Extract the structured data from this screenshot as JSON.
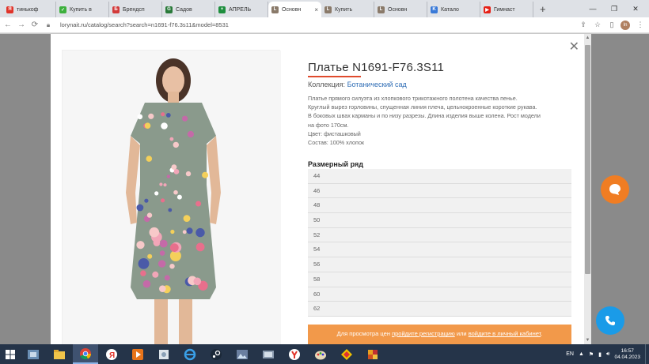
{
  "browser": {
    "tabs": [
      {
        "label": "тинькоф",
        "color": "#e0342a",
        "glyph": "Я"
      },
      {
        "label": "Купить в",
        "color": "#3db03d",
        "glyph": "✓"
      },
      {
        "label": "Брендсп",
        "color": "#d23a3a",
        "glyph": "Б"
      },
      {
        "label": "Садов",
        "color": "#2a7a3a",
        "glyph": "G"
      },
      {
        "label": "АПРЕЛЬ",
        "color": "#1e8e3e",
        "glyph": "+"
      },
      {
        "label": "Основн",
        "color": "#8a7a6a",
        "glyph": "L"
      },
      {
        "label": "Купить",
        "color": "#8a7a6a",
        "glyph": "L"
      },
      {
        "label": "Основн",
        "color": "#8a7a6a",
        "glyph": "L"
      },
      {
        "label": "Катало",
        "color": "#3a7ad8",
        "glyph": "K"
      },
      {
        "label": "Гимнаст",
        "color": "#e62117",
        "glyph": "▶"
      }
    ],
    "active_tab_index": 5,
    "url": "lorynait.ru/catalog/search?search=n1691-f76.3s11&model=8531",
    "avatar_initial": "In"
  },
  "product": {
    "title": "Платье N1691-F76.3S11",
    "collection_label": "Коллекция:",
    "collection_value": "Ботанический сад",
    "description": [
      "Платье прямого силуэта из хлопкового трикотажного полотена качества пенье.",
      "Круглый вырез горловины, спущенная линия плеча, цельнокроенные короткие рукава.",
      "В боковых швах карманы и по низу разрезы. Длина изделия выше колена. Рост модели",
      "на фото 170см.",
      "Цвет: фисташковый",
      "Состав: 100% хлопок"
    ],
    "sizes_heading": "Размерный ряд",
    "sizes": [
      "44",
      "46",
      "48",
      "50",
      "52",
      "54",
      "56",
      "58",
      "60",
      "62"
    ],
    "banner": {
      "prefix": "Для просмотра цен",
      "link1": "пройдите регистрацию",
      "middle": "или",
      "link2": "войдите в личный кабинет",
      "suffix": "."
    },
    "dress_color": "#8a9a8c"
  },
  "taskbar": {
    "lang": "EN",
    "time": "16:57",
    "date": "04.04.2023"
  }
}
